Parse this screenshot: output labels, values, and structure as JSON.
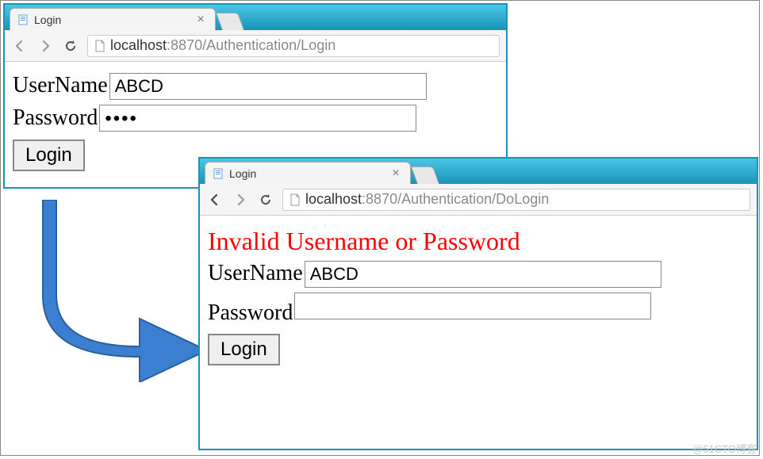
{
  "window1": {
    "tab_title": "Login",
    "url": {
      "host": "localhost",
      "port": ":8870",
      "path": "/Authentication/Login"
    },
    "form": {
      "username_label": "UserName",
      "username_value": "ABCD",
      "password_label": "Password",
      "password_masked": "••••",
      "login_button": "Login"
    }
  },
  "window2": {
    "tab_title": "Login",
    "url": {
      "host": "localhost",
      "port": ":8870",
      "path": "/Authentication/DoLogin"
    },
    "error": "Invalid Username or Password",
    "form": {
      "username_label": "UserName",
      "username_value": "ABCD",
      "password_label": "Password",
      "password_masked": "",
      "login_button": "Login"
    }
  },
  "watermark": "@51CTO博客"
}
